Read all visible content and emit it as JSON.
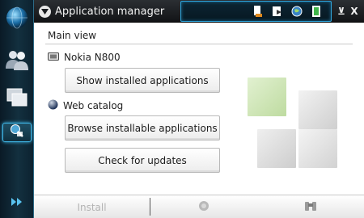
{
  "window": {
    "title": "Application manager",
    "menu_icon": "chevron-down-icon",
    "minimize_label": "⊻",
    "close_label": "X"
  },
  "status_area": {
    "icons": [
      "connectivity-icon",
      "internet-radio-icon",
      "web-globe-icon",
      "battery-icon"
    ]
  },
  "navigator": {
    "items": [
      "web-browser-icon",
      "contacts-icon",
      "application-switcher-icon",
      "application-manager-icon",
      "expand-arrow-icon"
    ]
  },
  "main_view": {
    "section_title": "Main view",
    "device": {
      "label": "Nokia N800",
      "icon": "device-icon",
      "button_label": "Show installed applications"
    },
    "catalog": {
      "label": "Web catalog",
      "icon": "globe-icon",
      "browse_label": "Browse installable applications",
      "updates_label": "Check for updates"
    },
    "graphic": {
      "name": "application-manager-graphic",
      "colors": {
        "green": "#cfe5b4",
        "gray": "#e3e3e3",
        "dark_gray": "#c9c9c9"
      }
    }
  },
  "toolbar": {
    "install_label": "Install",
    "install_enabled": false,
    "details_icon": "details-icon",
    "search_icon": "search-binoculars-icon"
  },
  "colors": {
    "accent": "#3fb6e6",
    "title_bar": "#1a1d20",
    "content_bg": "#ffffff"
  }
}
